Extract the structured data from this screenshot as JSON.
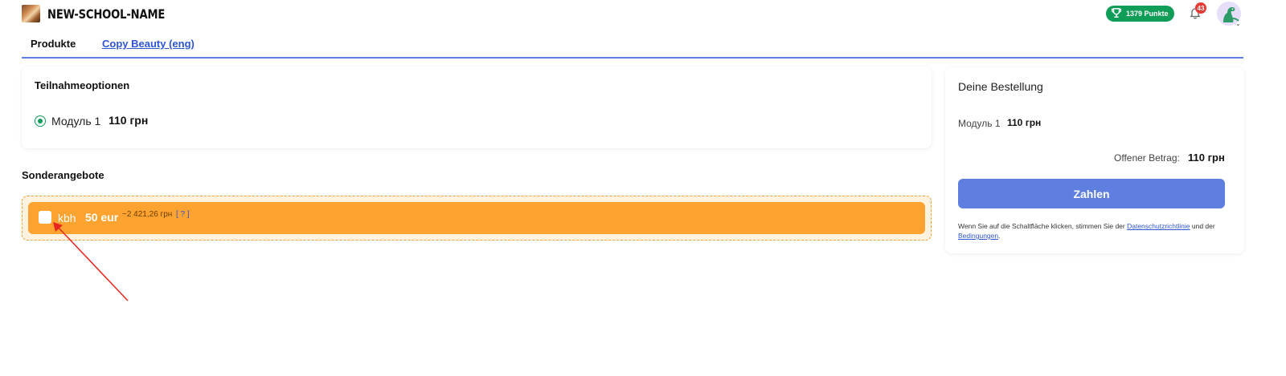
{
  "header": {
    "school_name": "NEW-SCHOOL-NAME",
    "points": "1379 Punkte",
    "notifications_count": "43",
    "icons": {
      "logo": "school-logo",
      "trophy": "trophy-icon",
      "bell": "bell-icon",
      "avatar": "dino-avatar"
    }
  },
  "breadcrumb": {
    "prefix": "Produkte",
    "link": "Copy Beauty (eng)"
  },
  "options": {
    "title": "Teilnahmeoptionen",
    "item_name": "Модуль 1",
    "item_price": "110 грн"
  },
  "specials": {
    "title": "Sonderangebote",
    "offer_name": "kbh",
    "offer_price": "50 eur",
    "offer_converted": "~2 421,26 грн",
    "offer_help": "[ ? ]"
  },
  "order": {
    "title": "Deine Bestellung",
    "item_name": "Модуль 1",
    "item_price": "110 грн",
    "open_amount_label": "Offener Betrag:",
    "open_amount": "110 грн",
    "pay_button": "Zahlen",
    "terms_part1": "Wenn Sie auf die Schaltfläche klicken, stimmen Sie der ",
    "terms_link1": "Datenschutzrichtlinie",
    "terms_part2": " und der ",
    "terms_link2": "Bedingungen",
    "terms_part3": "."
  },
  "colors": {
    "accent": "#5f7fe0",
    "points_green": "#0f9d58",
    "offer_orange": "#ffa330",
    "annotation_red": "#e8261e"
  }
}
